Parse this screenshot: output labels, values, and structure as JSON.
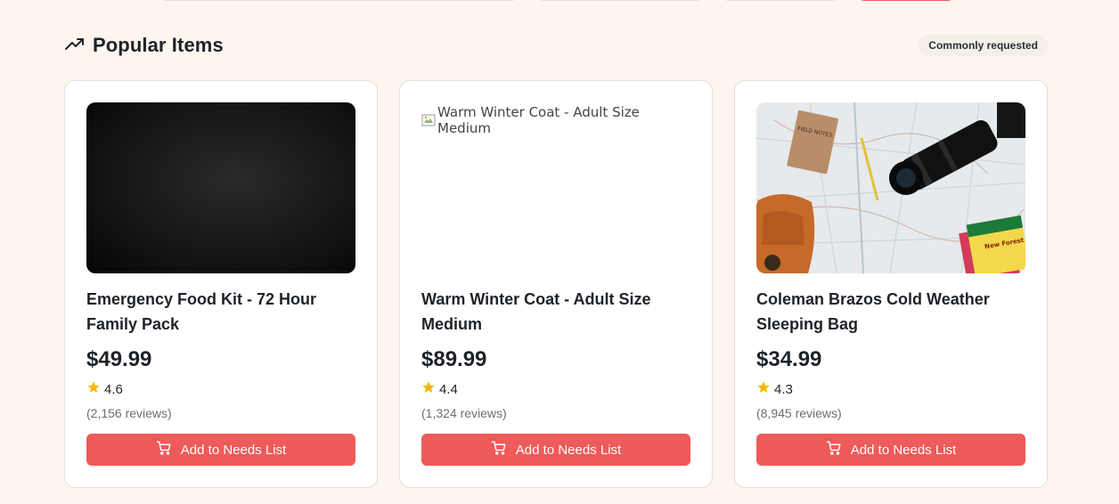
{
  "section": {
    "title": "Popular Items",
    "icon": "trending-up-icon",
    "badge": "Commonly requested"
  },
  "colors": {
    "accent": "#ef5a5a",
    "background": "#fef5ef",
    "star": "#f5b800"
  },
  "items": [
    {
      "title": "Emergency Food Kit - 72 Hour Family Pack",
      "price": "$49.99",
      "rating": "4.6",
      "reviews": "(2,156 reviews)",
      "image_type": "dark-photo",
      "button_label": "Add to Needs List"
    },
    {
      "title": "Warm Winter Coat - Adult Size Medium",
      "price": "$89.99",
      "rating": "4.4",
      "reviews": "(1,324 reviews)",
      "image_type": "broken-image",
      "image_alt": "Warm Winter Coat - Adult Size Medium",
      "button_label": "Add to Needs List"
    },
    {
      "title": "Coleman Brazos Cold Weather Sleeping Bag",
      "price": "$34.99",
      "rating": "4.3",
      "reviews": "(8,945 reviews)",
      "image_type": "map-photo",
      "image_texts": [
        "FIELD NOTES",
        "New Forest"
      ],
      "button_label": "Add to Needs List"
    }
  ]
}
